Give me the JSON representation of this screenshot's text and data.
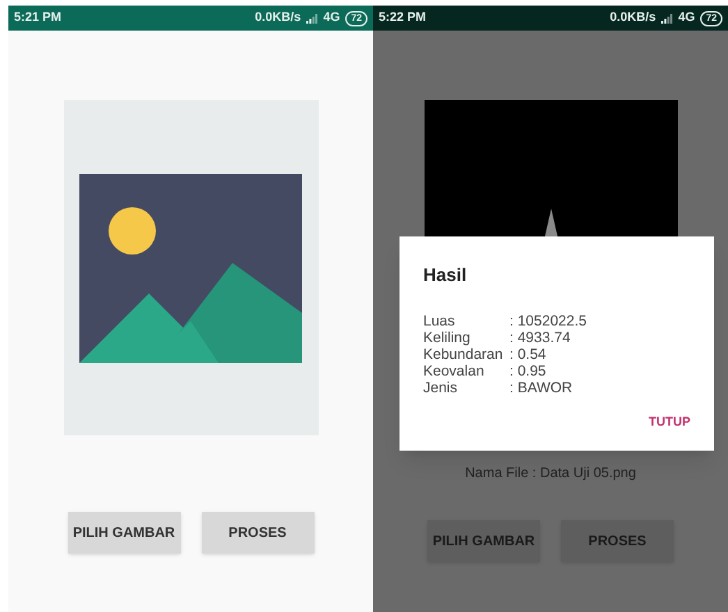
{
  "screens": [
    {
      "status_bar": {
        "time": "5:21 PM",
        "speed": "0.0KB/s",
        "network": "4G",
        "battery": "72"
      },
      "dimmed": false,
      "image": {
        "kind": "placeholder"
      },
      "buttons": [
        "PILIH GAMBAR",
        "PROSES"
      ]
    },
    {
      "status_bar": {
        "time": "5:22 PM",
        "speed": "0.0KB/s",
        "network": "4G",
        "battery": "72"
      },
      "dimmed": true,
      "image": {
        "kind": "result"
      },
      "file_name": "Nama File : Data Uji 05.png",
      "buttons": [
        "PILIH GAMBAR",
        "PROSES"
      ],
      "dialog": {
        "title": "Hasil",
        "rows": [
          {
            "label": "Luas",
            "value": ": 1052022.5"
          },
          {
            "label": "Keliling",
            "value": ": 4933.74"
          },
          {
            "label": "Kebundaran",
            "value": ": 0.54"
          },
          {
            "label": "Keovalan",
            "value": ": 0.95"
          },
          {
            "label": "Jenis",
            "value": ": BAWOR"
          }
        ],
        "action": "TUTUP"
      }
    }
  ]
}
